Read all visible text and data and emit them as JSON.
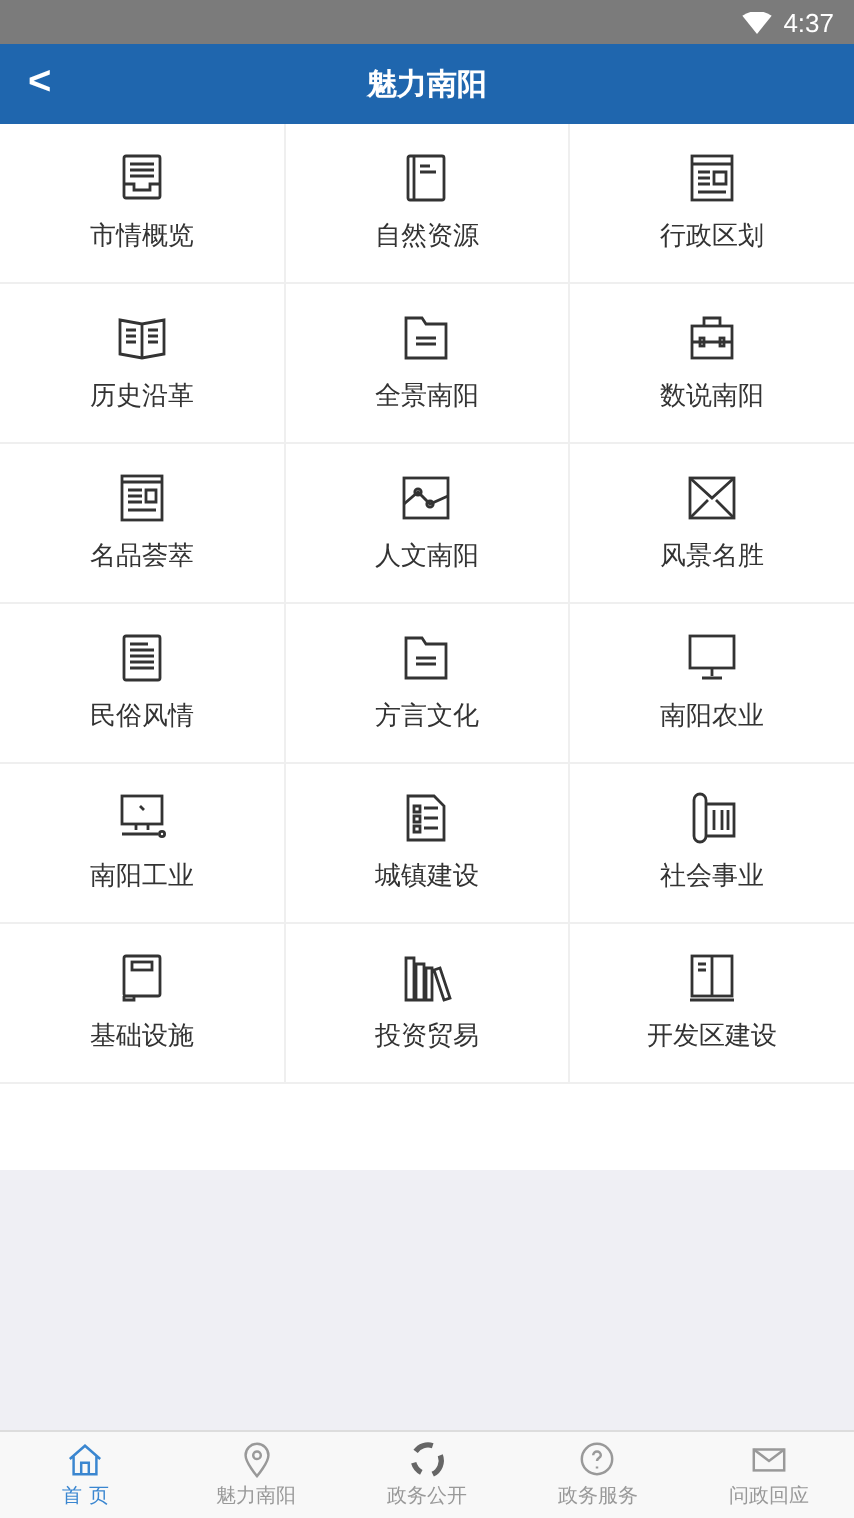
{
  "status_bar": {
    "time": "4:37"
  },
  "header": {
    "back": "<",
    "title": "魅力南阳"
  },
  "grid": [
    {
      "label": "市情概览",
      "kind": "tray"
    },
    {
      "label": "自然资源",
      "kind": "book"
    },
    {
      "label": "行政区划",
      "kind": "newspaper"
    },
    {
      "label": "历史沿革",
      "kind": "openbook"
    },
    {
      "label": "全景南阳",
      "kind": "folder"
    },
    {
      "label": "数说南阳",
      "kind": "briefcase"
    },
    {
      "label": "名品荟萃",
      "kind": "webpage"
    },
    {
      "label": "人文南阳",
      "kind": "chart"
    },
    {
      "label": "风景名胜",
      "kind": "envelope"
    },
    {
      "label": "民俗风情",
      "kind": "document"
    },
    {
      "label": "方言文化",
      "kind": "folder"
    },
    {
      "label": "南阳农业",
      "kind": "monitor"
    },
    {
      "label": "南阳工业",
      "kind": "computer"
    },
    {
      "label": "城镇建设",
      "kind": "checklist"
    },
    {
      "label": "社会事业",
      "kind": "scroll"
    },
    {
      "label": "基础设施",
      "kind": "notebook"
    },
    {
      "label": "投资贸易",
      "kind": "books"
    },
    {
      "label": "开发区建设",
      "kind": "cabinet"
    }
  ],
  "tab_bar": [
    {
      "label": "首 页",
      "kind": "home",
      "selected": true
    },
    {
      "label": "魅力南阳",
      "kind": "pin",
      "selected": false
    },
    {
      "label": "政务公开",
      "kind": "spinner",
      "selected": false
    },
    {
      "label": "政务服务",
      "kind": "help",
      "selected": false
    },
    {
      "label": "问政回应",
      "kind": "mail",
      "selected": false
    }
  ]
}
